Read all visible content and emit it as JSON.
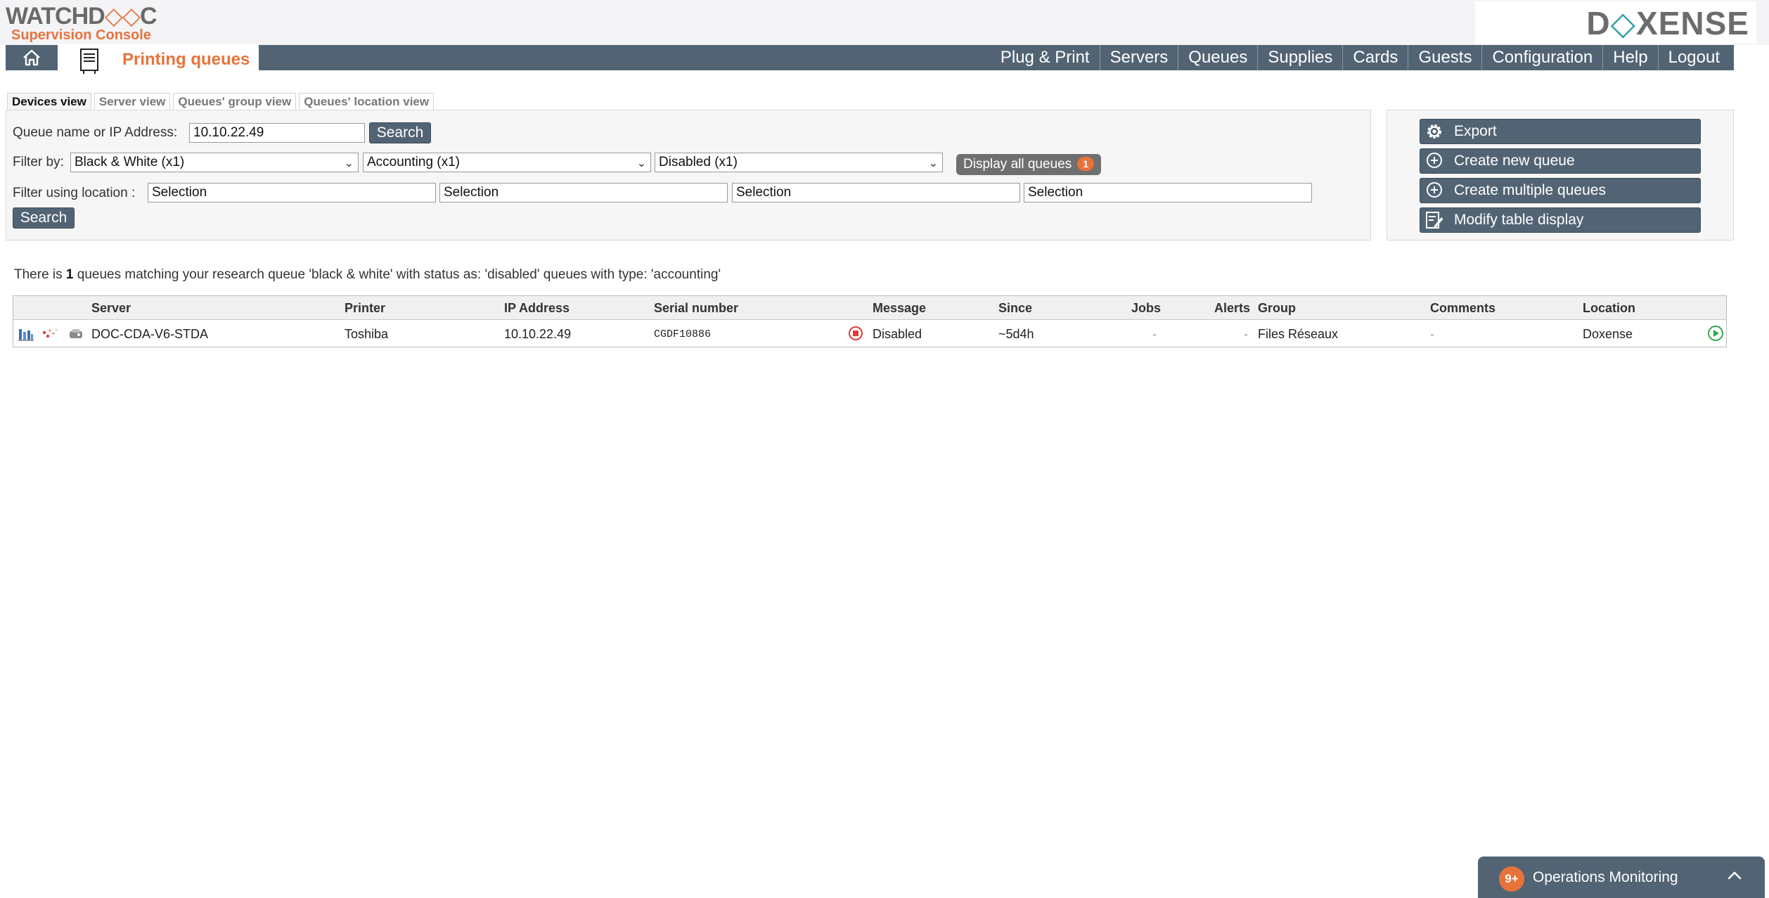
{
  "header": {
    "brand_left_main_a": "WATCHD",
    "brand_left_main_b": "◇◇",
    "brand_left_main_c": "C",
    "brand_left_sub": "Supervision Console",
    "brand_right_a": "D",
    "brand_right_b": "◇",
    "brand_right_c": "XENSE"
  },
  "nav": {
    "page_title": "Printing queues",
    "items": [
      "Plug & Print",
      "Servers",
      "Queues",
      "Supplies",
      "Cards",
      "Guests",
      "Configuration",
      "Help",
      "Logout"
    ]
  },
  "view_tabs": [
    "Devices view",
    "Server view",
    "Queues' group view",
    "Queues' location view"
  ],
  "filters": {
    "queue_label": "Queue name or IP Address:",
    "queue_value": "10.10.22.49",
    "search_label": "Search",
    "filter_by_label": "Filter by:",
    "filter_1": "Black & White (x1)",
    "filter_2": "Accounting (x1)",
    "filter_3": "Disabled (x1)",
    "display_all_label": "Display all queues",
    "display_all_count": "1",
    "location_label": "Filter using location :",
    "location_1": "Selection",
    "location_2": "Selection",
    "location_3": "Selection",
    "location_4": "Selection",
    "search_bottom_label": "Search"
  },
  "actions": {
    "export": "Export",
    "create_new": "Create new queue",
    "create_multiple": "Create multiple queues",
    "modify_table": "Modify table display"
  },
  "result": {
    "prefix": "There is",
    "count": "1",
    "suffix": "queues matching your research queue 'black & white' with status as: 'disabled' queues with type: 'accounting'"
  },
  "table": {
    "headers": {
      "server": "Server",
      "printer": "Printer",
      "ip": "IP Address",
      "serial": "Serial number",
      "message": "Message",
      "since": "Since",
      "jobs": "Jobs",
      "alerts": "Alerts",
      "group": "Group",
      "comments": "Comments",
      "location": "Location"
    },
    "rows": [
      {
        "server": "DOC-CDA-V6-STDA",
        "printer": "Toshiba",
        "ip": "10.10.22.49",
        "serial": "CGDF10886",
        "message": "Disabled",
        "since": "~5d4h",
        "jobs": "-",
        "alerts": "-",
        "group": "Files Réseaux",
        "comments": "-",
        "location": "Doxense"
      }
    ]
  },
  "ops_monitoring": {
    "count": "9+",
    "label": "Operations Monitoring"
  },
  "colors": {
    "accent": "#e8733a",
    "nav": "#526474",
    "teal": "#2e9ea6"
  }
}
